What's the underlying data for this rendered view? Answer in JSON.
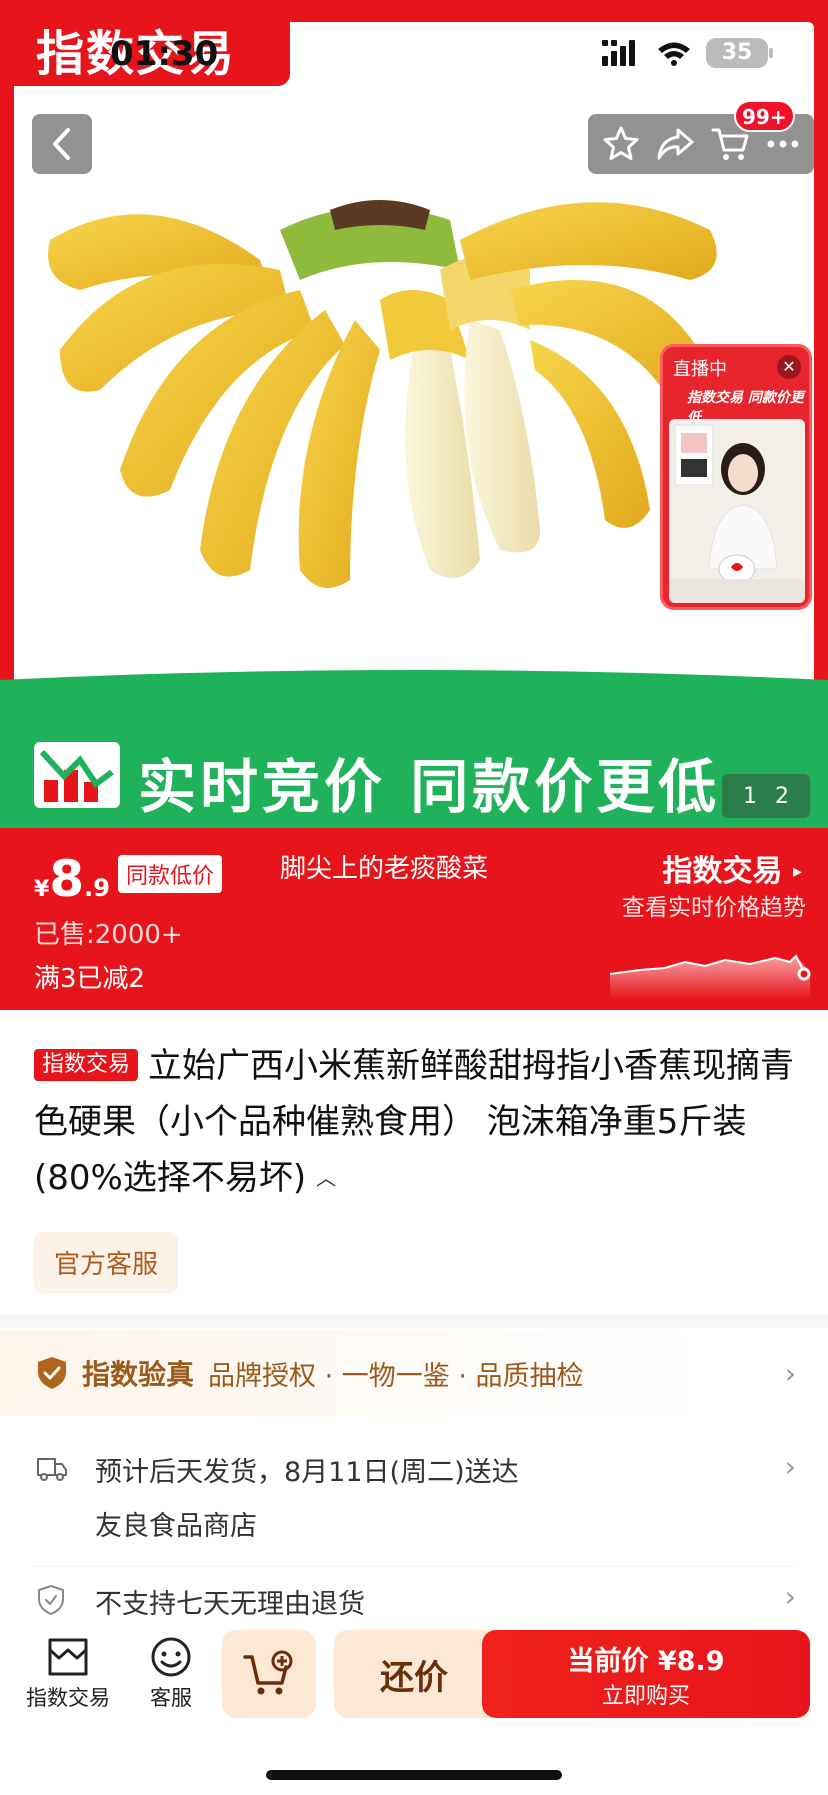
{
  "status_bar": {
    "time": "01:30",
    "battery": "35"
  },
  "hero": {
    "corner_tag": "指数交易",
    "cart_badge": "99+",
    "live_card": {
      "label": "直播中",
      "title": "指数交易 同款价更低"
    },
    "band_text": "实时竞价 同款价更低",
    "image_counter": {
      "current": "1",
      "total": "2"
    }
  },
  "price_banner": {
    "currency": "¥",
    "price_int": "8",
    "price_dec": ".9",
    "same_price_tag": "同款低价",
    "shop_name": "脚尖上的老痰酸菜",
    "sold": "已售:2000+",
    "discount": "满3已减2",
    "index_trade_title": "指数交易",
    "index_trade_subtitle": "查看实时价格趋势"
  },
  "product": {
    "tag": "指数交易",
    "title": "立始广西小米蕉新鲜酸甜拇指小香蕉现摘青色硬果（小个品种催熟食用） 泡沫箱净重5斤装(80%选择不易坏)",
    "service_chip": "官方客服"
  },
  "verify": {
    "title": "指数验真",
    "desc": "品牌授权 · 一物一鉴 · 品质抽检"
  },
  "shipping": {
    "line1": "预计后天发货，8月11日(周二)送达",
    "line2": "友良食品商店"
  },
  "returns": {
    "text": "不支持七天无理由退货"
  },
  "bottom_bar": {
    "tab_store": "指数交易",
    "tab_service": "客服",
    "bargain": "还价",
    "buy_line1": "当前价 ¥8.9",
    "buy_line2": "立即购买"
  },
  "colors": {
    "brand_red": "#e8141b",
    "band_green": "#1fb25a",
    "gold": "#9a5a1c"
  }
}
